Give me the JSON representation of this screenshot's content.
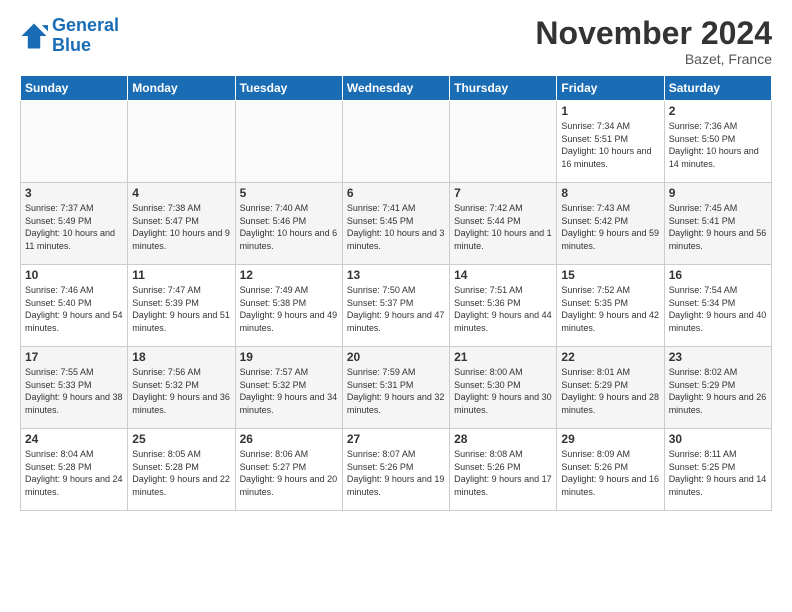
{
  "logo": {
    "line1": "General",
    "line2": "Blue"
  },
  "title": "November 2024",
  "location": "Bazet, France",
  "days_of_week": [
    "Sunday",
    "Monday",
    "Tuesday",
    "Wednesday",
    "Thursday",
    "Friday",
    "Saturday"
  ],
  "weeks": [
    [
      {
        "day": "",
        "info": ""
      },
      {
        "day": "",
        "info": ""
      },
      {
        "day": "",
        "info": ""
      },
      {
        "day": "",
        "info": ""
      },
      {
        "day": "",
        "info": ""
      },
      {
        "day": "1",
        "info": "Sunrise: 7:34 AM\nSunset: 5:51 PM\nDaylight: 10 hours and 16 minutes."
      },
      {
        "day": "2",
        "info": "Sunrise: 7:36 AM\nSunset: 5:50 PM\nDaylight: 10 hours and 14 minutes."
      }
    ],
    [
      {
        "day": "3",
        "info": "Sunrise: 7:37 AM\nSunset: 5:49 PM\nDaylight: 10 hours and 11 minutes."
      },
      {
        "day": "4",
        "info": "Sunrise: 7:38 AM\nSunset: 5:47 PM\nDaylight: 10 hours and 9 minutes."
      },
      {
        "day": "5",
        "info": "Sunrise: 7:40 AM\nSunset: 5:46 PM\nDaylight: 10 hours and 6 minutes."
      },
      {
        "day": "6",
        "info": "Sunrise: 7:41 AM\nSunset: 5:45 PM\nDaylight: 10 hours and 3 minutes."
      },
      {
        "day": "7",
        "info": "Sunrise: 7:42 AM\nSunset: 5:44 PM\nDaylight: 10 hours and 1 minute."
      },
      {
        "day": "8",
        "info": "Sunrise: 7:43 AM\nSunset: 5:42 PM\nDaylight: 9 hours and 59 minutes."
      },
      {
        "day": "9",
        "info": "Sunrise: 7:45 AM\nSunset: 5:41 PM\nDaylight: 9 hours and 56 minutes."
      }
    ],
    [
      {
        "day": "10",
        "info": "Sunrise: 7:46 AM\nSunset: 5:40 PM\nDaylight: 9 hours and 54 minutes."
      },
      {
        "day": "11",
        "info": "Sunrise: 7:47 AM\nSunset: 5:39 PM\nDaylight: 9 hours and 51 minutes."
      },
      {
        "day": "12",
        "info": "Sunrise: 7:49 AM\nSunset: 5:38 PM\nDaylight: 9 hours and 49 minutes."
      },
      {
        "day": "13",
        "info": "Sunrise: 7:50 AM\nSunset: 5:37 PM\nDaylight: 9 hours and 47 minutes."
      },
      {
        "day": "14",
        "info": "Sunrise: 7:51 AM\nSunset: 5:36 PM\nDaylight: 9 hours and 44 minutes."
      },
      {
        "day": "15",
        "info": "Sunrise: 7:52 AM\nSunset: 5:35 PM\nDaylight: 9 hours and 42 minutes."
      },
      {
        "day": "16",
        "info": "Sunrise: 7:54 AM\nSunset: 5:34 PM\nDaylight: 9 hours and 40 minutes."
      }
    ],
    [
      {
        "day": "17",
        "info": "Sunrise: 7:55 AM\nSunset: 5:33 PM\nDaylight: 9 hours and 38 minutes."
      },
      {
        "day": "18",
        "info": "Sunrise: 7:56 AM\nSunset: 5:32 PM\nDaylight: 9 hours and 36 minutes."
      },
      {
        "day": "19",
        "info": "Sunrise: 7:57 AM\nSunset: 5:32 PM\nDaylight: 9 hours and 34 minutes."
      },
      {
        "day": "20",
        "info": "Sunrise: 7:59 AM\nSunset: 5:31 PM\nDaylight: 9 hours and 32 minutes."
      },
      {
        "day": "21",
        "info": "Sunrise: 8:00 AM\nSunset: 5:30 PM\nDaylight: 9 hours and 30 minutes."
      },
      {
        "day": "22",
        "info": "Sunrise: 8:01 AM\nSunset: 5:29 PM\nDaylight: 9 hours and 28 minutes."
      },
      {
        "day": "23",
        "info": "Sunrise: 8:02 AM\nSunset: 5:29 PM\nDaylight: 9 hours and 26 minutes."
      }
    ],
    [
      {
        "day": "24",
        "info": "Sunrise: 8:04 AM\nSunset: 5:28 PM\nDaylight: 9 hours and 24 minutes."
      },
      {
        "day": "25",
        "info": "Sunrise: 8:05 AM\nSunset: 5:28 PM\nDaylight: 9 hours and 22 minutes."
      },
      {
        "day": "26",
        "info": "Sunrise: 8:06 AM\nSunset: 5:27 PM\nDaylight: 9 hours and 20 minutes."
      },
      {
        "day": "27",
        "info": "Sunrise: 8:07 AM\nSunset: 5:26 PM\nDaylight: 9 hours and 19 minutes."
      },
      {
        "day": "28",
        "info": "Sunrise: 8:08 AM\nSunset: 5:26 PM\nDaylight: 9 hours and 17 minutes."
      },
      {
        "day": "29",
        "info": "Sunrise: 8:09 AM\nSunset: 5:26 PM\nDaylight: 9 hours and 16 minutes."
      },
      {
        "day": "30",
        "info": "Sunrise: 8:11 AM\nSunset: 5:25 PM\nDaylight: 9 hours and 14 minutes."
      }
    ]
  ]
}
